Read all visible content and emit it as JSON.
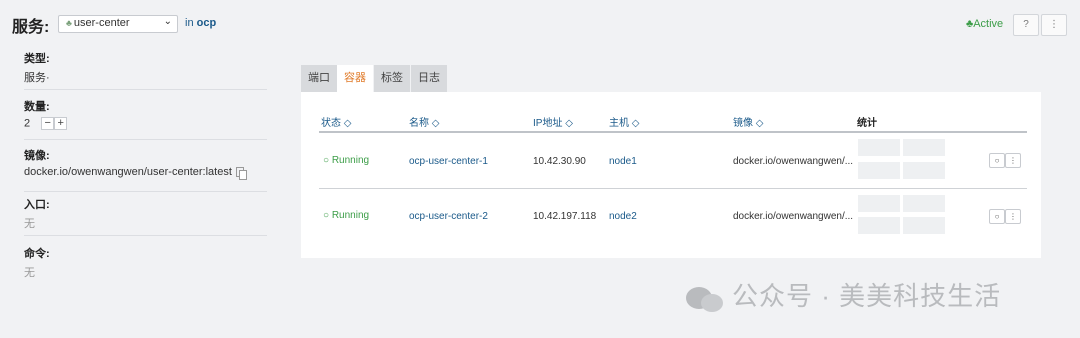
{
  "header": {
    "title": "服务:",
    "service_select": {
      "value": "user-center",
      "icon": "service-icon"
    },
    "namespace_prefix": "in",
    "namespace": "ocp",
    "status": "Active",
    "status_color": "#3c9d48"
  },
  "sidebar": {
    "type_label": "类型:",
    "type_value": "服务·",
    "scale_label": "数量:",
    "scale_value": "2",
    "scale_minus": "−",
    "scale_plus": "+",
    "image_label": "镜像:",
    "image_value": "docker.io/owenwangwen/user-center:latest",
    "entry_label": "入口:",
    "entry_value": "无",
    "command_label": "命令:",
    "command_value": "无"
  },
  "tabs": [
    {
      "label": "端口"
    },
    {
      "label": "容器",
      "active": true
    },
    {
      "label": "标签"
    },
    {
      "label": "日志"
    }
  ],
  "table": {
    "headers": {
      "state": "状态 ◇",
      "name": "名称 ◇",
      "ip": "IP地址 ◇",
      "host": "主机 ◇",
      "image": "镜像 ◇",
      "stats": "统计"
    },
    "rows": [
      {
        "state": "Running",
        "name": "ocp-user-center-1",
        "ip": "10.42.30.90",
        "host": "node1",
        "image": "docker.io/owenwangwen/..."
      },
      {
        "state": "Running",
        "name": "ocp-user-center-2",
        "ip": "10.42.197.118",
        "host": "node2",
        "image": "docker.io/owenwangwen/..."
      }
    ]
  },
  "watermark": "公众号 · 美美科技生活"
}
